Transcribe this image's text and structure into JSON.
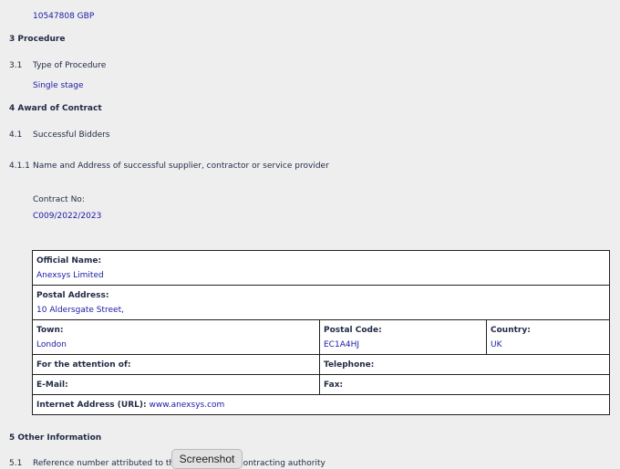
{
  "value": {
    "amount": "10547808 GBP"
  },
  "section3": {
    "heading": "3 Procedure",
    "item_3_1": {
      "number": "3.1",
      "label": "Type of Procedure",
      "value": "Single stage"
    }
  },
  "section4": {
    "heading": "4 Award of Contract",
    "item_4_1": {
      "number": "4.1",
      "label": "Successful Bidders"
    },
    "item_4_1_1": {
      "number": "4.1.1",
      "label": "Name and Address of successful supplier, contractor or service provider"
    },
    "contract_no_label": "Contract No:",
    "contract_no_value": "C009/2022/2023"
  },
  "contractor": {
    "official_name_label": "Official Name:",
    "official_name": "Anexsys Limited",
    "postal_address_label": "Postal Address:",
    "postal_address": "10 Aldersgate Street,",
    "town_label": "Town:",
    "town": "London",
    "postal_code_label": "Postal Code:",
    "postal_code": "EC1A4HJ",
    "country_label": "Country:",
    "country": "UK",
    "attention_label": "For the attention of:",
    "telephone_label": "Telephone:",
    "email_label": "E-Mail:",
    "fax_label": "Fax:",
    "url_label": "Internet Address (URL):",
    "url": "www.anexsys.com"
  },
  "section5": {
    "heading": "5 Other Information",
    "item_5_1": {
      "number": "5.1",
      "label": "Reference number attributed to the notice by the contracting authority"
    }
  },
  "overlay": {
    "screenshot_button": "Screenshot"
  }
}
